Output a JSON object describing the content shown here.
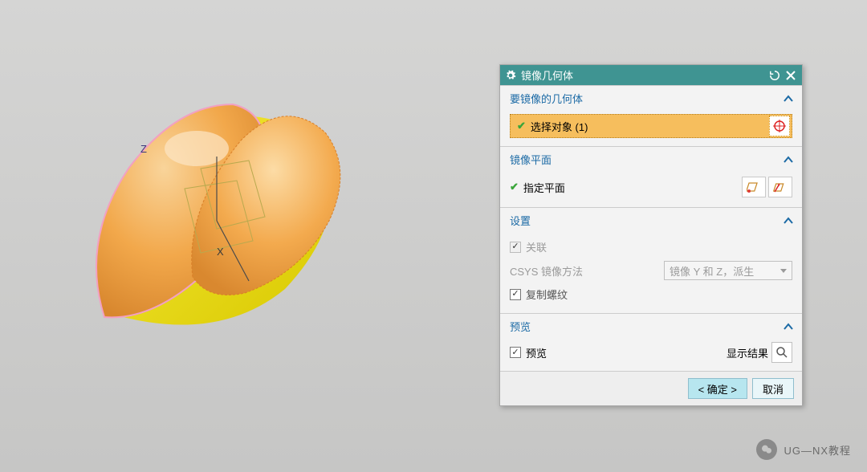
{
  "dialog": {
    "title": "镜像几何体",
    "sections": {
      "geometry": {
        "header": "要镜像的几何体",
        "select_label": "选择对象 (1)"
      },
      "plane": {
        "header": "镜像平面",
        "specify_label": "指定平面"
      },
      "settings": {
        "header": "设置",
        "associative_label": "关联",
        "csys_label": "CSYS 镜像方法",
        "csys_value": "镜像 Y 和 Z，派生",
        "copy_threads_label": "复制螺纹"
      },
      "preview": {
        "header": "预览",
        "checkbox_label": "预览",
        "show_result_label": "显示结果"
      }
    },
    "buttons": {
      "ok": "< 确定 >",
      "cancel": "取消"
    }
  },
  "watermark": "UG—NX教程",
  "axes": {
    "z": "Z",
    "x": "X"
  }
}
